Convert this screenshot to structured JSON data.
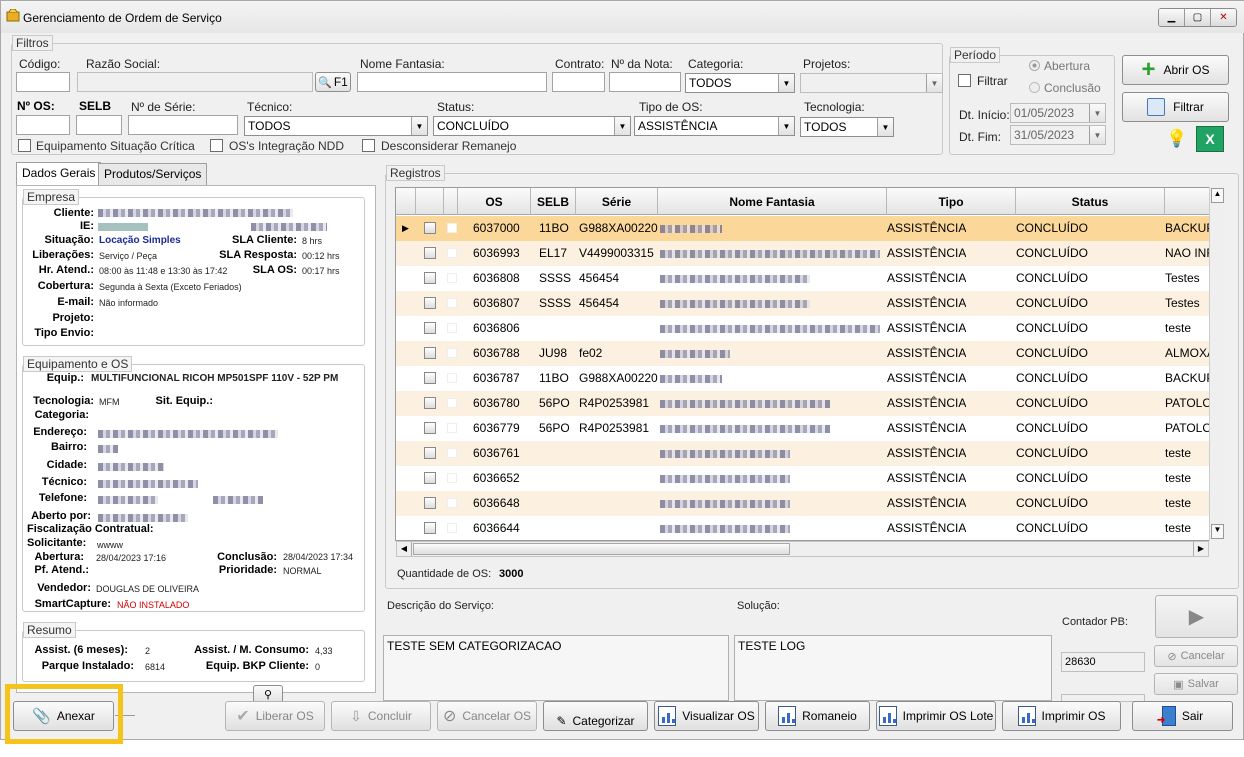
{
  "window": {
    "title": "Gerenciamento de Ordem de Serviço"
  },
  "filtros": {
    "legend": "Filtros",
    "codigo_label": "Código:",
    "razao_label": "Razão Social:",
    "f1_label": "F1",
    "fantasia_label": "Nome Fantasia:",
    "contrato_label": "Contrato:",
    "nota_label": "Nº da Nota:",
    "categoria_label": "Categoria:",
    "categoria_value": "TODOS",
    "projetos_label": "Projetos:",
    "os_label": "Nº OS:",
    "selb_label": "SELB",
    "serie_label": "Nº de Série:",
    "tecnico_label": "Técnico:",
    "tecnico_value": "TODOS",
    "status_label": "Status:",
    "status_value": "CONCLUÍDO",
    "tipo_label": "Tipo de OS:",
    "tipo_value": "ASSISTÊNCIA",
    "tecnologia_label": "Tecnologia:",
    "tecnologia_value": "TODOS",
    "chk_situacao": "Equipamento Situação Crítica",
    "chk_ndd": "OS's Integração NDD",
    "chk_remanejo": "Desconsiderar Remanejo"
  },
  "periodo": {
    "legend": "Período",
    "filtrar": "Filtrar",
    "abertura": "Abertura",
    "conclusao": "Conclusão",
    "inicio_label": "Dt. Início:",
    "inicio_value": "01/05/2023",
    "fim_label": "Dt. Fim:",
    "fim_value": "31/05/2023"
  },
  "actions": {
    "abrir_os": "Abrir OS",
    "filtrar": "Filtrar"
  },
  "tabs": [
    "Dados Gerais",
    "Produtos/Serviços"
  ],
  "empresa": {
    "legend": "Empresa",
    "cliente_label": "Cliente:",
    "ie_label": "IE:",
    "situacao_label": "Situação:",
    "situacao_value": "Locação Simples",
    "sla_cliente_label": "SLA Cliente:",
    "sla_cliente_value": "8 hrs",
    "liberacoes_label": "Liberações:",
    "liberacoes_value": "Serviço / Peça",
    "sla_resposta_label": "SLA Resposta:",
    "sla_resposta_value": "00:12 hrs",
    "hr_atend_label": "Hr. Atend.:",
    "hr_atend_value": "08:00 às 11:48 e 13:30 às 17:42",
    "sla_os_label": "SLA OS:",
    "sla_os_value": "00:17 hrs",
    "cobertura_label": "Cobertura:",
    "cobertura_value": "Segunda à Sexta (Exceto Feriados)",
    "email_label": "E-mail:",
    "email_value": "Não informado",
    "projeto_label": "Projeto:",
    "tipo_envio_label": "Tipo Envio:"
  },
  "equipamento": {
    "legend": "Equipamento e OS",
    "equip_label": "Equip.:",
    "equip_value": "MULTIFUNCIONAL RICOH MP501SPF 110V - 52P PM",
    "tecnologia_label": "Tecnologia:",
    "tecnologia_value": "MFM",
    "sit_equip_label": "Sit. Equip.:",
    "categoria_label": "Categoria:",
    "endereco_label": "Endereço:",
    "bairro_label": "Bairro:",
    "cidade_label": "Cidade:",
    "tecnico_label": "Técnico:",
    "telefone_label": "Telefone:",
    "aberto_label": "Aberto por:",
    "fiscalizacao_label": "Fiscalização Contratual:",
    "solicitante_label": "Solicitante:",
    "solicitante_value": "wwww",
    "abertura_label": "Abertura:",
    "abertura_value": "28/04/2023 17:16",
    "conclusao_label": "Conclusão:",
    "conclusao_value": "28/04/2023 17:34",
    "pf_label": "Pf. Atend.:",
    "prioridade_label": "Prioridade:",
    "prioridade_value": "NORMAL",
    "vendedor_label": "Vendedor:",
    "vendedor_value": "DOUGLAS DE OLIVEIRA",
    "smart_label": "SmartCapture:",
    "smart_value": "NÃO INSTALADO"
  },
  "resumo": {
    "legend": "Resumo",
    "assist_label": "Assist. (6 meses):",
    "assist_value": "2",
    "consumo_label": "Assist. / M. Consumo:",
    "consumo_value": "4,33",
    "parque_label": "Parque Instalado:",
    "parque_value": "6814",
    "bkp_label": "Equip. BKP Cliente:",
    "bkp_value": "0"
  },
  "registros": {
    "legend": "Registros",
    "columns": [
      "OS",
      "SELB",
      "Série",
      "Nome Fantasia",
      "Tipo",
      "Status"
    ],
    "rows": [
      {
        "os": "6037000",
        "selb": "11BO",
        "serie": "G988XA00220",
        "tipo": "ASSISTÊNCIA",
        "status": "CONCLUÍDO",
        "extra": "BACKUP"
      },
      {
        "os": "6036993",
        "selb": "EL17",
        "serie": "V4499003315",
        "tipo": "ASSISTÊNCIA",
        "status": "CONCLUÍDO",
        "extra": "NAO INF"
      },
      {
        "os": "6036808",
        "selb": "SSSS",
        "serie": "456454",
        "tipo": "ASSISTÊNCIA",
        "status": "CONCLUÍDO",
        "extra": "Testes"
      },
      {
        "os": "6036807",
        "selb": "SSSS",
        "serie": "456454",
        "tipo": "ASSISTÊNCIA",
        "status": "CONCLUÍDO",
        "extra": "Testes"
      },
      {
        "os": "6036806",
        "selb": "",
        "serie": "",
        "tipo": "ASSISTÊNCIA",
        "status": "CONCLUÍDO",
        "extra": "teste"
      },
      {
        "os": "6036788",
        "selb": "JU98",
        "serie": "fe02",
        "tipo": "ASSISTÊNCIA",
        "status": "CONCLUÍDO",
        "extra": "ALMOXA"
      },
      {
        "os": "6036787",
        "selb": "11BO",
        "serie": "G988XA00220",
        "tipo": "ASSISTÊNCIA",
        "status": "CONCLUÍDO",
        "extra": "BACKUP"
      },
      {
        "os": "6036780",
        "selb": "56PO",
        "serie": "R4P0253981",
        "tipo": "ASSISTÊNCIA",
        "status": "CONCLUÍDO",
        "extra": "PATOLO"
      },
      {
        "os": "6036779",
        "selb": "56PO",
        "serie": "R4P0253981",
        "tipo": "ASSISTÊNCIA",
        "status": "CONCLUÍDO",
        "extra": "PATOLO"
      },
      {
        "os": "6036761",
        "selb": "",
        "serie": "",
        "tipo": "ASSISTÊNCIA",
        "status": "CONCLUÍDO",
        "extra": "teste"
      },
      {
        "os": "6036652",
        "selb": "",
        "serie": "",
        "tipo": "ASSISTÊNCIA",
        "status": "CONCLUÍDO",
        "extra": "teste"
      },
      {
        "os": "6036648",
        "selb": "",
        "serie": "",
        "tipo": "ASSISTÊNCIA",
        "status": "CONCLUÍDO",
        "extra": "teste"
      },
      {
        "os": "6036644",
        "selb": "",
        "serie": "",
        "tipo": "ASSISTÊNCIA",
        "status": "CONCLUÍDO",
        "extra": "teste"
      }
    ],
    "quantidade_label": "Quantidade de OS:",
    "quantidade_value": "3000"
  },
  "detalhe": {
    "descricao_label": "Descrição do Serviço:",
    "descricao_value": "TESTE SEM CATEGORIZACAO",
    "solucao_label": "Solução:",
    "solucao_value": "TESTE LOG",
    "contador_label": "Contador PB:",
    "contador_value": "28630",
    "cancelar": "Cancelar",
    "salvar": "Salvar"
  },
  "bottom": {
    "anexar": "Anexar",
    "liberar_os": "Liberar OS",
    "concluir": "Concluir",
    "cancelar_os": "Cancelar OS",
    "categorizar": "Categorizar",
    "visualizar_os": "Visualizar OS",
    "romaneio": "Romaneio",
    "imprimir_lote": "Imprimir OS Lote",
    "imprimir_os": "Imprimir OS",
    "sair": "Sair"
  },
  "colors": {
    "highlight": "#f4c41a",
    "selected_row": "#fbd79a",
    "alt_row": "#fcf1e0"
  }
}
